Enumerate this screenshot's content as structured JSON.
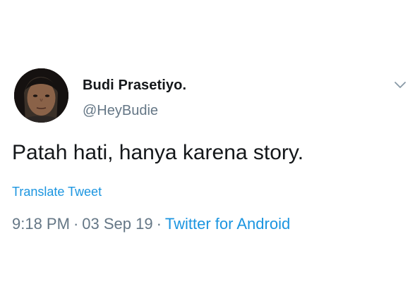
{
  "tweet": {
    "author": {
      "display_name": "Budi Prasetiyo.",
      "handle": "@HeyBudie",
      "avatar_icon": "user-avatar"
    },
    "menu_icon": "chevron-down-icon",
    "text": "Patah hati, hanya karena story.",
    "translate_label": "Translate Tweet",
    "time": "9:18 PM",
    "date": "03 Sep 19",
    "separator": "·",
    "source": "Twitter for Android"
  },
  "colors": {
    "text": "#14171a",
    "secondary": "#657786",
    "link": "#1b95e0",
    "background": "#ffffff"
  }
}
